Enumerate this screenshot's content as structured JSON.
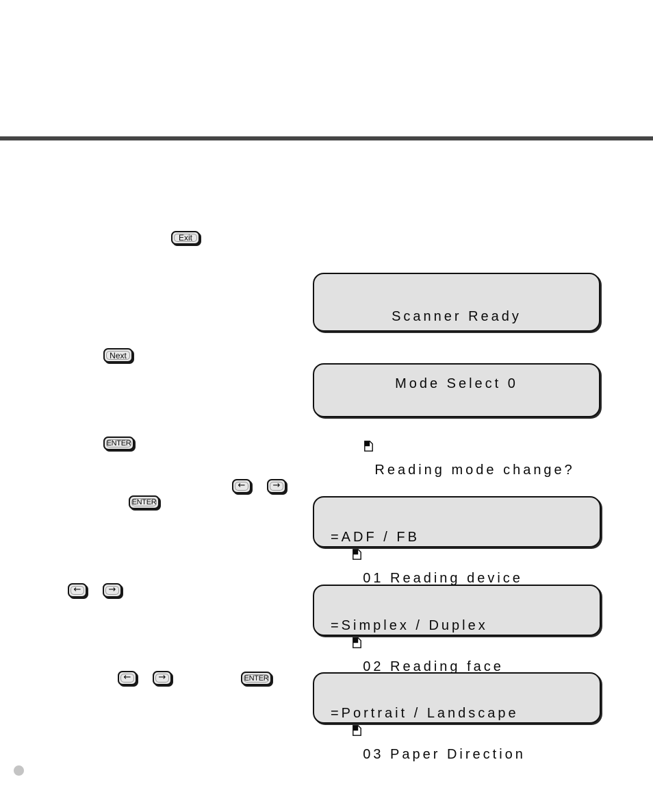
{
  "page": {
    "background_color": "#ffffff",
    "rule_color": "#454545",
    "dot_color": "#c4c4c4"
  },
  "keys": [
    {
      "id": "exit",
      "label": "Exit",
      "icon": "none"
    },
    {
      "id": "next",
      "label": "Next",
      "icon": "none"
    },
    {
      "id": "enter1",
      "label": "ENTER",
      "icon": "none"
    },
    {
      "id": "enter2",
      "label": "ENTER",
      "icon": "none"
    },
    {
      "id": "enter3",
      "label": "ENTER",
      "icon": "none"
    },
    {
      "id": "left1",
      "label": "←",
      "icon": "arrow-left-icon"
    },
    {
      "id": "right1",
      "label": "→",
      "icon": "arrow-right-icon"
    },
    {
      "id": "left2",
      "label": "←",
      "icon": "arrow-left-icon"
    },
    {
      "id": "right2",
      "label": "→",
      "icon": "arrow-right-icon"
    },
    {
      "id": "left3",
      "label": "←",
      "icon": "arrow-left-icon"
    },
    {
      "id": "right3",
      "label": "→",
      "icon": "arrow-right-icon"
    }
  ],
  "lcd_panels": [
    {
      "id": "panel-scanner-ready",
      "line1": "Scanner Ready",
      "line2": "",
      "align": "center",
      "line1_has_page_icon": false,
      "line2_has_page_icon": false
    },
    {
      "id": "panel-mode-select",
      "line1": "Mode Select 0",
      "line2": "Reading mode change?",
      "align": "center",
      "line1_has_page_icon": false,
      "line2_has_page_icon": true
    },
    {
      "id": "panel-01-reading-device",
      "line1": "01 Reading device",
      "line2": "=ADF / FB",
      "align": "left",
      "line1_has_page_icon": true,
      "line2_has_page_icon": false
    },
    {
      "id": "panel-02-reading-face",
      "line1": "02 Reading face",
      "line2": "=Simplex / Duplex",
      "align": "left",
      "line1_has_page_icon": true,
      "line2_has_page_icon": false
    },
    {
      "id": "panel-03-paper-direction",
      "line1": "03 Paper Direction",
      "line2": "=Portrait / Landscape",
      "align": "left",
      "line1_has_page_icon": true,
      "line2_has_page_icon": false
    }
  ]
}
